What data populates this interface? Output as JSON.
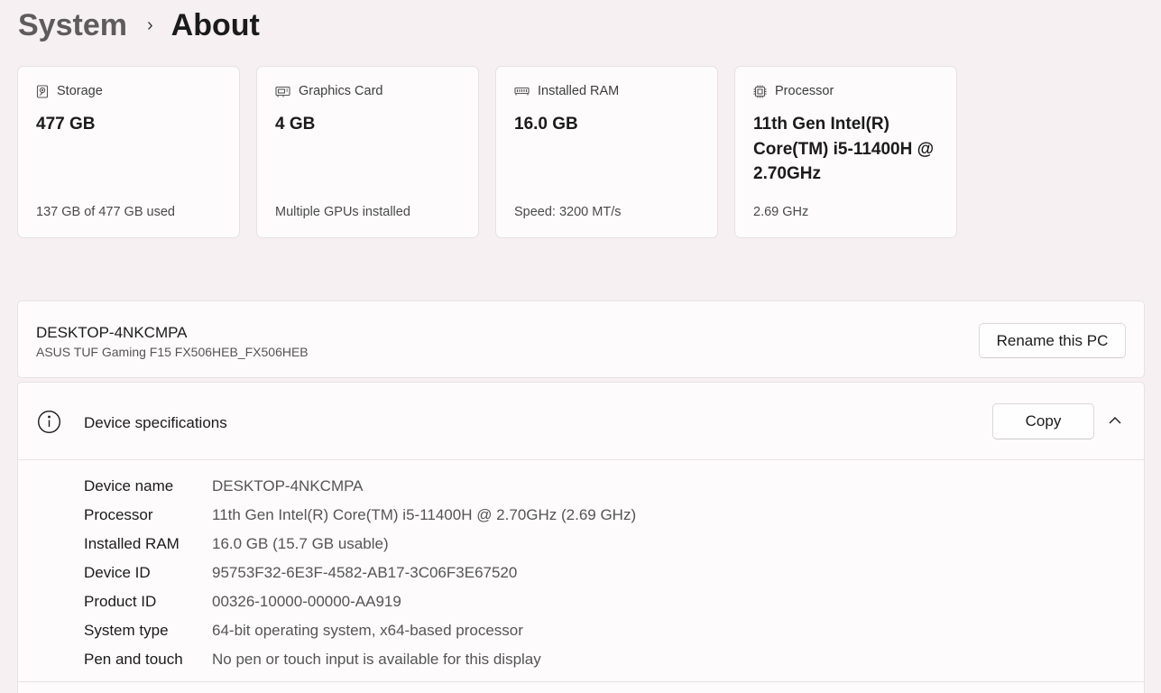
{
  "breadcrumb": {
    "parent": "System",
    "separator": "›",
    "current": "About"
  },
  "tiles": [
    {
      "icon": "storage-icon",
      "label": "Storage",
      "value": "477 GB",
      "detail": "137 GB of 477 GB used"
    },
    {
      "icon": "graphics-card-icon",
      "label": "Graphics Card",
      "value": "4 GB",
      "detail": "Multiple GPUs installed"
    },
    {
      "icon": "ram-icon",
      "label": "Installed RAM",
      "value": "16.0 GB",
      "detail": "Speed: 3200 MT/s"
    },
    {
      "icon": "processor-icon",
      "label": "Processor",
      "value": "11th Gen Intel(R) Core(TM) i5-11400H @ 2.70GHz",
      "detail": "2.69 GHz"
    }
  ],
  "pc": {
    "name": "DESKTOP-4NKCMPA",
    "model": "ASUS TUF Gaming F15 FX506HEB_FX506HEB",
    "rename_label": "Rename this PC"
  },
  "device_specs": {
    "title": "Device specifications",
    "copy_label": "Copy",
    "rows": [
      {
        "label": "Device name",
        "value": "DESKTOP-4NKCMPA"
      },
      {
        "label": "Processor",
        "value": "11th Gen Intel(R) Core(TM) i5-11400H @ 2.70GHz (2.69 GHz)"
      },
      {
        "label": "Installed RAM",
        "value": "16.0 GB (15.7 GB usable)"
      },
      {
        "label": "Device ID",
        "value": "95753F32-6E3F-4582-AB17-3C06F3E67520"
      },
      {
        "label": "Product ID",
        "value": "00326-10000-00000-AA919"
      },
      {
        "label": "System type",
        "value": "64-bit operating system, x64-based processor"
      },
      {
        "label": "Pen and touch",
        "value": "No pen or touch input is available for this display"
      }
    ]
  }
}
